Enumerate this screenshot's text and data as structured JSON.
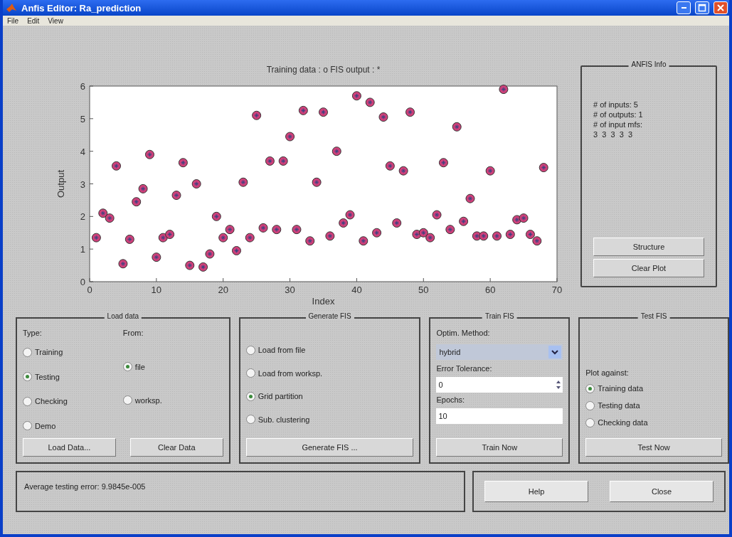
{
  "window": {
    "title": "Anfis Editor: Ra_prediction"
  },
  "menu": [
    "File",
    "Edit",
    "View"
  ],
  "plot": {
    "chart_data": {
      "type": "scatter",
      "title": "Training data : o   FIS output : *",
      "xlabel": "Index",
      "ylabel": "Output",
      "xlim": [
        0,
        70
      ],
      "ylim": [
        0,
        6
      ],
      "xticks": [
        0,
        10,
        20,
        30,
        40,
        50,
        60,
        70
      ],
      "yticks": [
        0,
        1,
        2,
        3,
        4,
        5,
        6
      ],
      "x": [
        1,
        2,
        3,
        4,
        5,
        6,
        7,
        8,
        9,
        10,
        11,
        12,
        13,
        14,
        15,
        16,
        17,
        18,
        19,
        20,
        21,
        22,
        23,
        24,
        25,
        26,
        27,
        28,
        29,
        30,
        31,
        32,
        33,
        34,
        35,
        36,
        37,
        38,
        39,
        40,
        41,
        42,
        43,
        44,
        45,
        46,
        47,
        48,
        49,
        50,
        51,
        52,
        53,
        54,
        55,
        56,
        57,
        58,
        59,
        60,
        61,
        62,
        63,
        64,
        65,
        66,
        67,
        68
      ],
      "series": [
        {
          "color": "#d0407a",
          "values": [
            1.35,
            2.1,
            1.95,
            3.55,
            0.55,
            1.3,
            2.45,
            2.85,
            3.9,
            0.75,
            1.35,
            1.45,
            2.65,
            3.65,
            0.5,
            3.0,
            0.45,
            0.85,
            2.0,
            1.35,
            1.6,
            0.95,
            3.05,
            1.35,
            5.1,
            1.65,
            3.7,
            1.6,
            3.7,
            4.45,
            1.6,
            5.25,
            1.25,
            3.05,
            5.2,
            1.4,
            4.0,
            1.8,
            2.05,
            5.7,
            1.25,
            5.5,
            1.5,
            5.05,
            3.55,
            1.8,
            3.4,
            5.2,
            1.45,
            1.5,
            1.35,
            2.05,
            3.65,
            1.6,
            4.75,
            1.85,
            2.55,
            1.4,
            1.4,
            3.4,
            1.4,
            5.9,
            1.45,
            1.9,
            1.95,
            1.45,
            1.25,
            3.5
          ]
        },
        {
          "color": "#404080",
          "values": [
            1.35,
            2.1,
            1.95,
            3.55,
            0.55,
            1.3,
            2.45,
            2.85,
            3.9,
            0.75,
            1.35,
            1.45,
            2.65,
            3.65,
            0.5,
            3.0,
            0.45,
            0.85,
            2.0,
            1.35,
            1.6,
            0.95,
            3.05,
            1.35,
            5.1,
            1.65,
            3.7,
            1.6,
            3.7,
            4.45,
            1.6,
            5.25,
            1.25,
            3.05,
            5.2,
            1.4,
            4.0,
            1.8,
            2.05,
            5.7,
            1.25,
            5.5,
            1.5,
            5.05,
            3.55,
            1.8,
            3.4,
            5.2,
            1.45,
            1.5,
            1.35,
            2.05,
            3.65,
            1.6,
            4.75,
            1.85,
            2.55,
            1.4,
            1.4,
            3.4,
            1.4,
            5.9,
            1.45,
            1.9,
            1.95,
            1.45,
            1.25,
            3.5
          ]
        }
      ]
    }
  },
  "anfis_info": {
    "title": "ANFIS Info",
    "lines": [
      "# of inputs: 5",
      "# of outputs: 1",
      "# of input mfs:",
      "3  3  3  3  3"
    ],
    "buttons": [
      "Structure",
      "Clear Plot"
    ]
  },
  "load_data": {
    "title": "Load data",
    "type_label": "Type:",
    "from_label": "From:",
    "type_options": [
      {
        "label": "Training",
        "selected": false
      },
      {
        "label": "Testing",
        "selected": true
      },
      {
        "label": "Checking",
        "selected": false
      },
      {
        "label": "Demo",
        "selected": false
      }
    ],
    "from_options": [
      {
        "label": "file",
        "selected": true
      },
      {
        "label": "worksp.",
        "selected": false
      }
    ],
    "buttons": [
      "Load Data...",
      "Clear Data"
    ]
  },
  "generate_fis": {
    "title": "Generate FIS",
    "options": [
      {
        "label": "Load from file",
        "selected": false
      },
      {
        "label": "Load from worksp.",
        "selected": false
      },
      {
        "label": "Grid partition",
        "selected": true
      },
      {
        "label": "Sub. clustering",
        "selected": false
      }
    ],
    "button": "Generate FIS ..."
  },
  "train_fis": {
    "title": "Train FIS",
    "method_label": "Optim. Method:",
    "method_value": "hybrid",
    "tolerance_label": "Error Tolerance:",
    "tolerance_value": "0",
    "epochs_label": "Epochs:",
    "epochs_value": "10",
    "button": "Train Now"
  },
  "test_fis": {
    "title": "Test FIS",
    "plot_against_label": "Plot against:",
    "options": [
      {
        "label": "Training data",
        "selected": true
      },
      {
        "label": "Testing data",
        "selected": false
      },
      {
        "label": "Checking data",
        "selected": false
      }
    ],
    "button": "Test Now"
  },
  "status": {
    "text": "Average testing error: 9.9845e-005"
  },
  "buttons": [
    "Help",
    "Close"
  ]
}
